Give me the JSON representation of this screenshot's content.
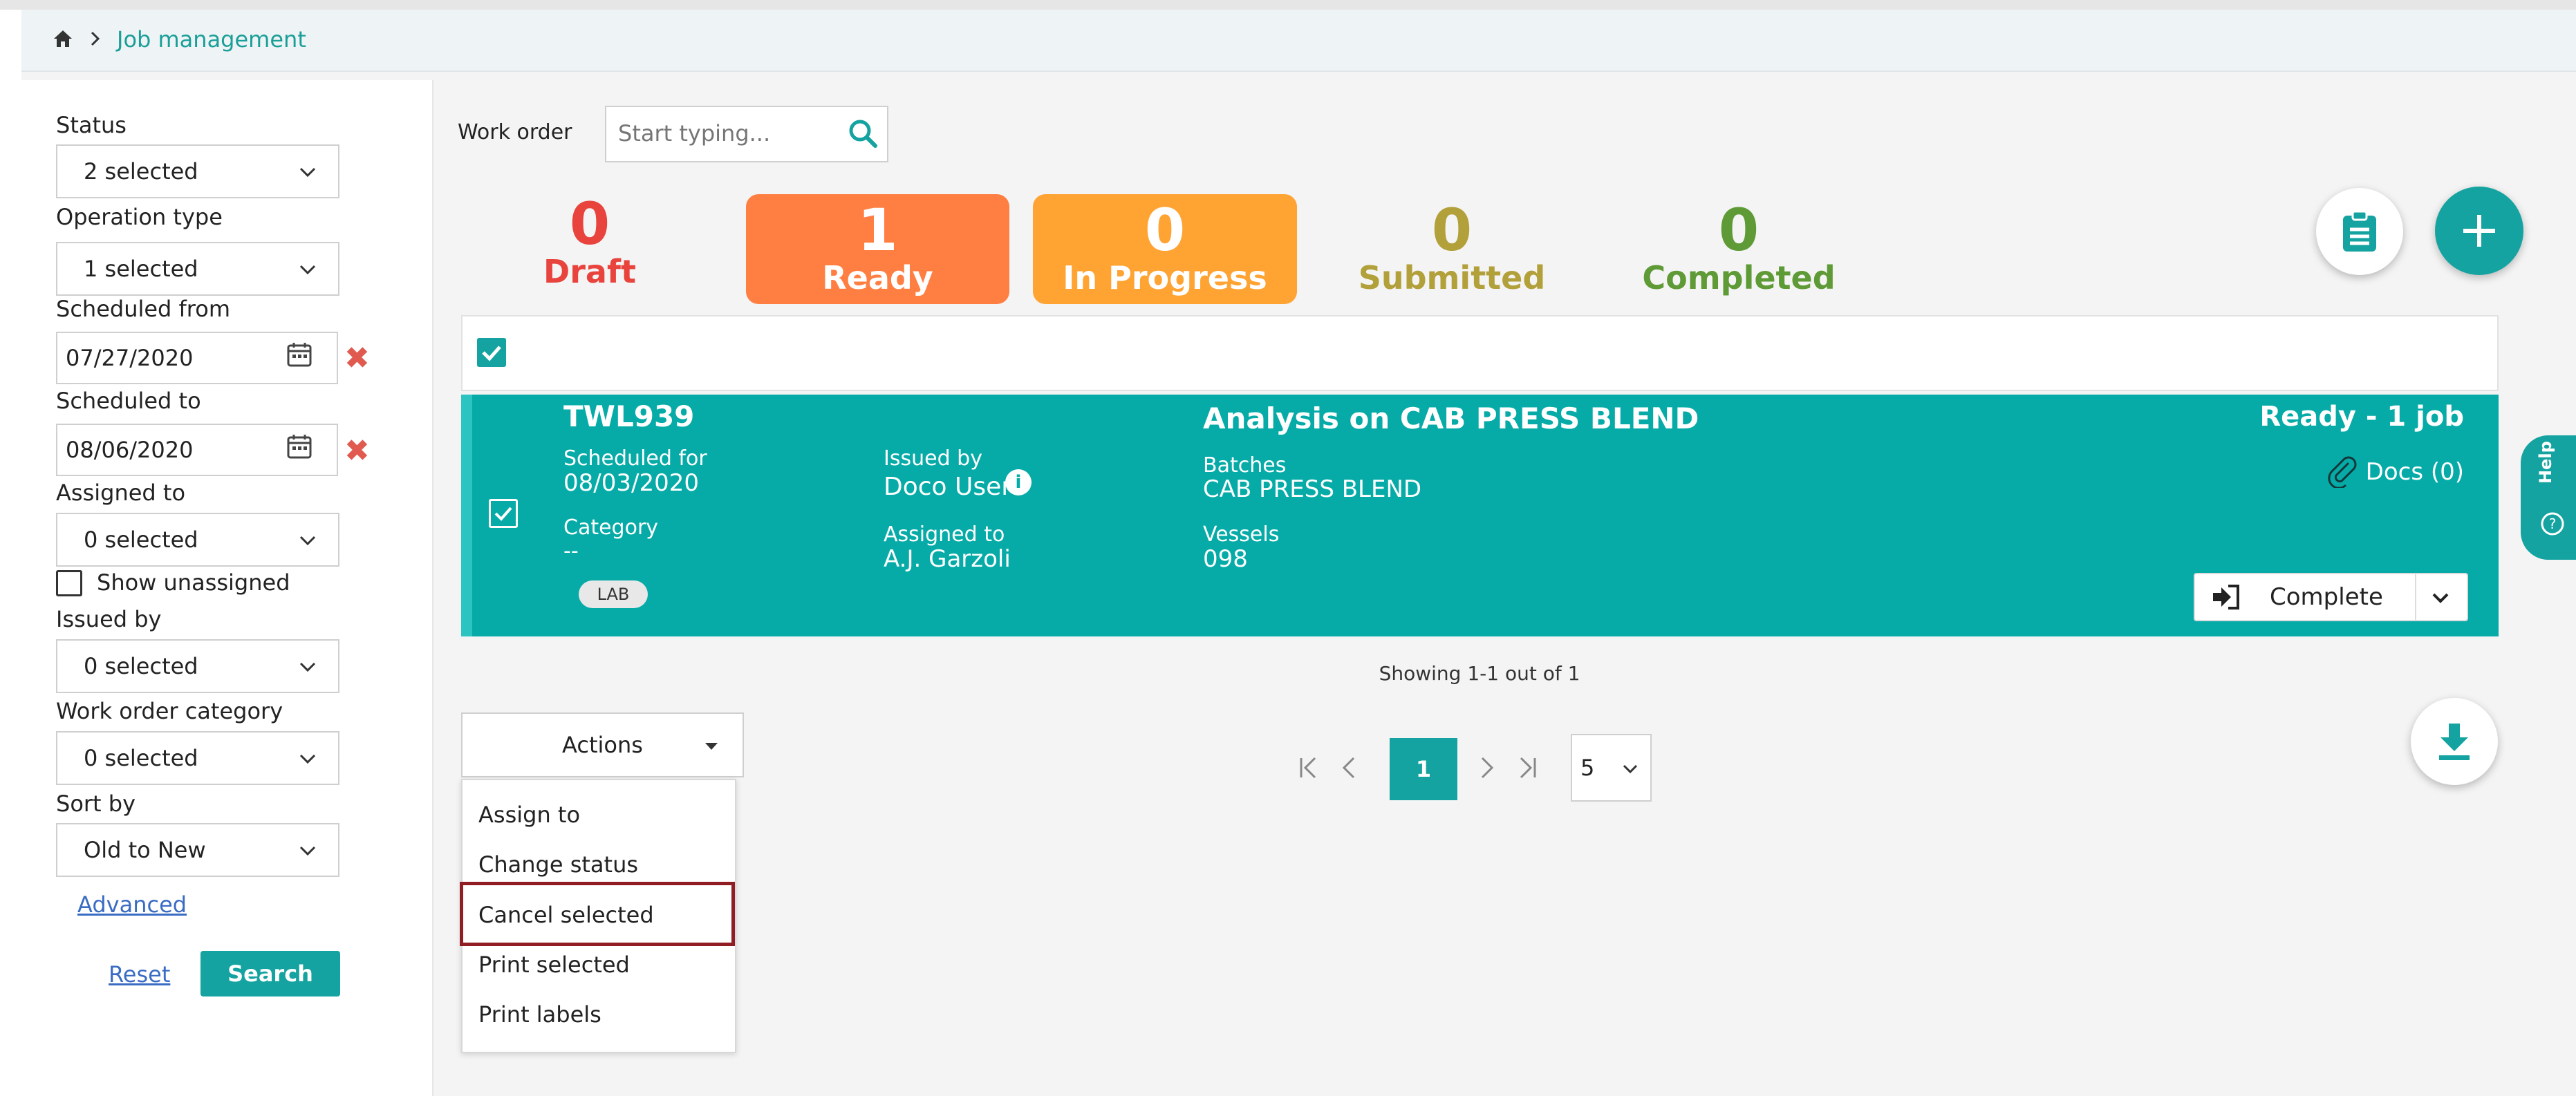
{
  "breadcrumb": {
    "current": "Job management"
  },
  "filters": {
    "status": {
      "label": "Status",
      "value": "2 selected"
    },
    "operation_type": {
      "label": "Operation type",
      "value": "1 selected"
    },
    "scheduled_from": {
      "label": "Scheduled from",
      "value": "07/27/2020"
    },
    "scheduled_to": {
      "label": "Scheduled to",
      "value": "08/06/2020"
    },
    "assigned_to": {
      "label": "Assigned to",
      "value": "0 selected"
    },
    "show_unassigned": {
      "label": "Show unassigned",
      "checked": false
    },
    "issued_by": {
      "label": "Issued by",
      "value": "0 selected"
    },
    "work_order_category": {
      "label": "Work order category",
      "value": "0 selected"
    },
    "sort_by": {
      "label": "Sort by",
      "value": "Old to New"
    },
    "advanced": "Advanced",
    "reset": "Reset",
    "search": "Search"
  },
  "work_order": {
    "label": "Work order",
    "placeholder": "Start typing..."
  },
  "status_counts": [
    {
      "count": "0",
      "label": "Draft",
      "color": "#e8433c"
    },
    {
      "count": "1",
      "label": "Ready",
      "color": "#ff7f42"
    },
    {
      "count": "0",
      "label": "In Progress",
      "color": "#ffa333"
    },
    {
      "count": "0",
      "label": "Submitted",
      "color": "#b2a03a"
    },
    {
      "count": "0",
      "label": "Completed",
      "color": "#5e9a35"
    }
  ],
  "job": {
    "id": "TWL939",
    "scheduled_label": "Scheduled for",
    "scheduled_value": "08/03/2020",
    "category_label": "Category",
    "category_value": "--",
    "tag": "LAB",
    "issued_label": "Issued by",
    "issued_value": "Doco User",
    "assigned_label": "Assigned to",
    "assigned_value": "A.J. Garzoli",
    "title": "Analysis on CAB PRESS BLEND",
    "batches_label": "Batches",
    "batches_value": "CAB PRESS BLEND",
    "vessels_label": "Vessels",
    "vessels_value": "098",
    "status_text": "Ready - 1 job",
    "docs": "Docs (0)",
    "complete_btn": "Complete",
    "color": "#06aba8"
  },
  "pagination": {
    "showing": "Showing 1-1 out of 1",
    "current_page": "1",
    "page_size": "5"
  },
  "actions": {
    "label": "Actions",
    "items": [
      "Assign to",
      "Change status",
      "Cancel selected",
      "Print selected",
      "Print labels"
    ]
  },
  "help": "Help"
}
